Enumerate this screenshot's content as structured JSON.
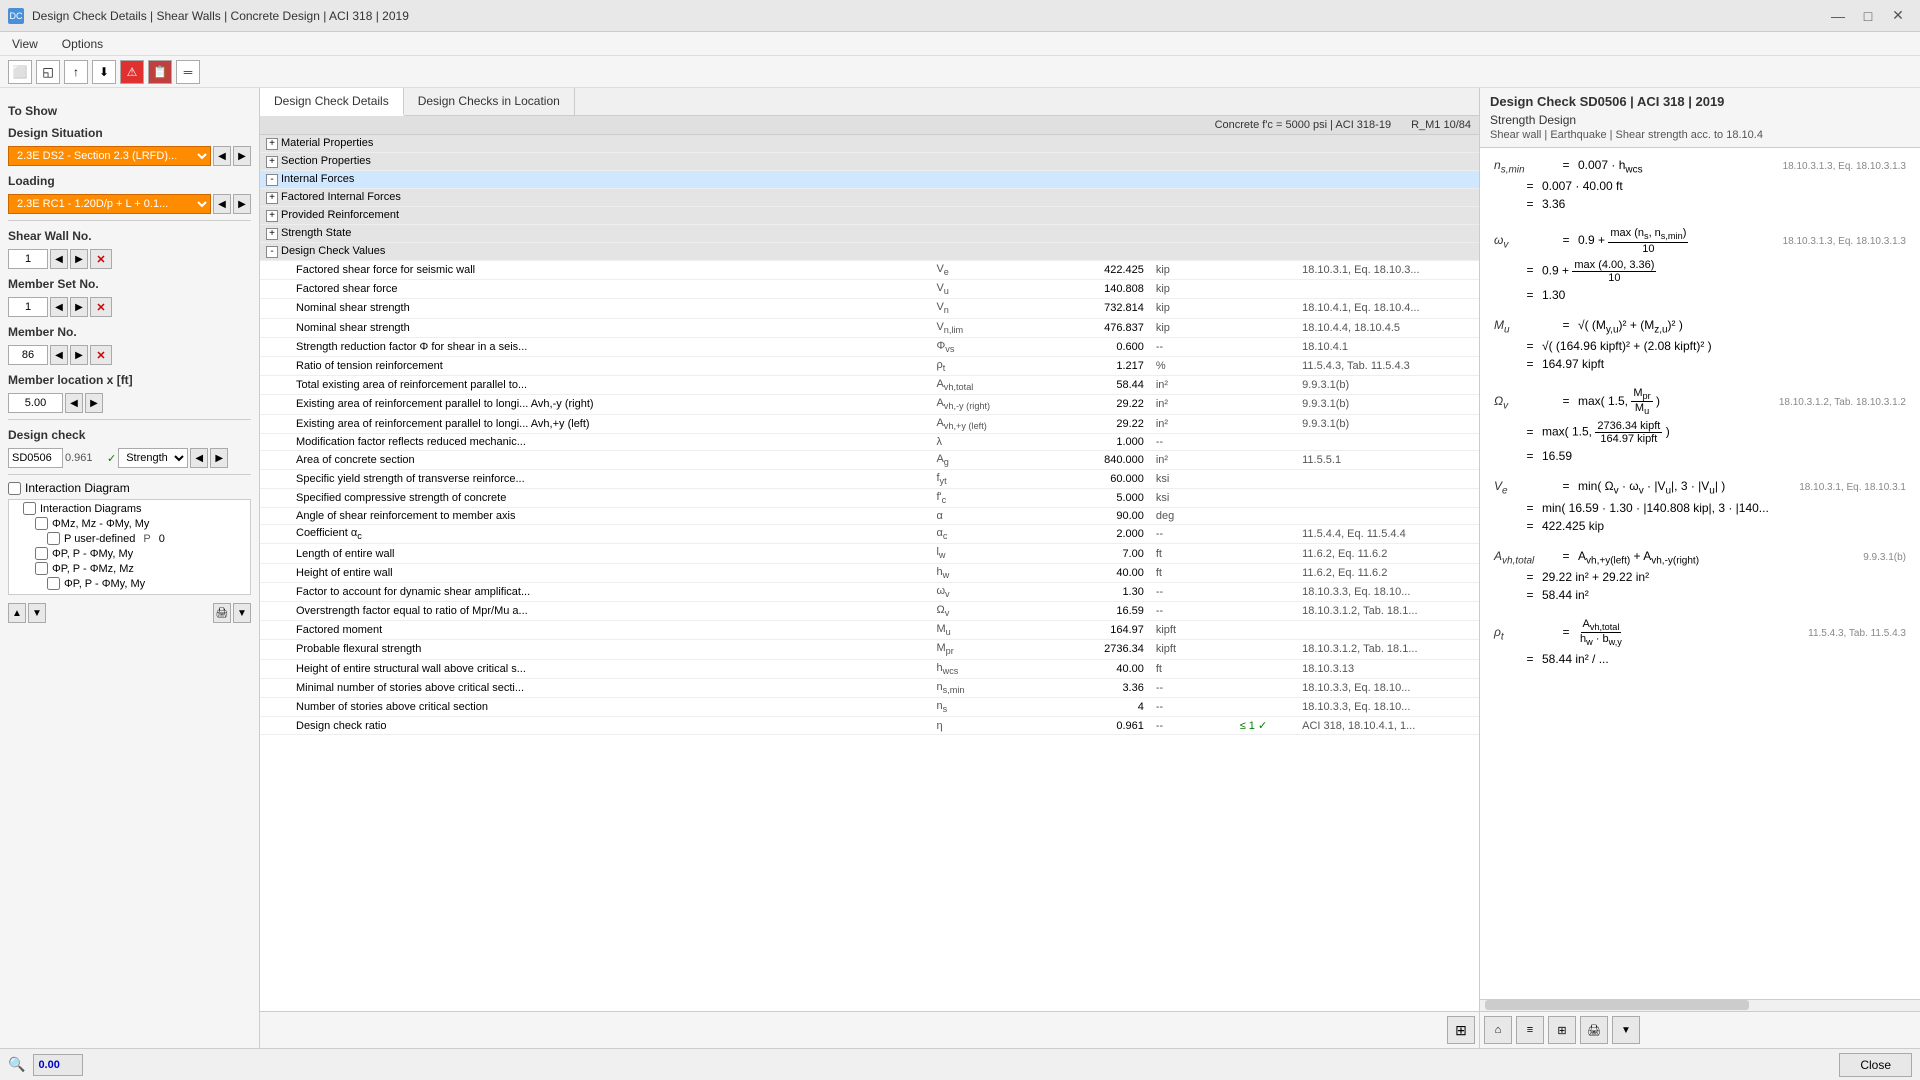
{
  "titleBar": {
    "icon": "DC",
    "title": "Design Check Details | Shear Walls | Concrete Design | ACI 318 | 2019",
    "minimizeBtn": "—",
    "maximizeBtn": "□",
    "closeBtn": "✕"
  },
  "menuBar": {
    "items": [
      "View",
      "Options"
    ]
  },
  "leftPanel": {
    "toShowLabel": "To Show",
    "designSituationLabel": "Design Situation",
    "designSituationValue": "2.3E  DS2 - Section 2.3 (LRFD)...",
    "loadingLabel": "Loading",
    "loadingValue": "2.3E  RC1 - 1.20D/p + L + 0.1...",
    "shearWallLabel": "Shear Wall No.",
    "shearWallNum": "1",
    "memberSetLabel": "Member Set No.",
    "memberSetNum": "1",
    "memberLabel": "Member No.",
    "memberNum": "86",
    "locationLabel": "Member location x [ft]",
    "locationValue": "5.00",
    "designCheckLabel": "Design check",
    "designCheckCode": "SD0506",
    "designCheckVal": "0.961",
    "designCheckStatus": "✓",
    "designCheckName": "Strength ...",
    "interactionLabel": "Interaction Diagram",
    "treeItems": [
      {
        "label": "Interaction Diagrams",
        "level": 1
      },
      {
        "label": "ΦMz, Mz - ΦMy, My",
        "level": 2
      },
      {
        "label": "P user-defined",
        "level": 3,
        "extra": "P   0"
      },
      {
        "label": "ΦP, P - ΦMy, My",
        "level": 2
      },
      {
        "label": "ΦP, P - ΦMz, Mz",
        "level": 2
      },
      {
        "label": "ΦP, P - ΦMy, My",
        "level": 3
      }
    ]
  },
  "centerPanel": {
    "tabs": [
      "Design Check Details",
      "Design Checks in Location"
    ],
    "activeTab": 0,
    "headerRight": "Concrete f'c = 5000 psi | ACI 318-19",
    "headerRight2": "R_M1 10/84",
    "sections": [
      {
        "id": "material",
        "label": "Material Properties",
        "expanded": false,
        "indent": 0
      },
      {
        "id": "section",
        "label": "Section Properties",
        "expanded": false,
        "indent": 0
      },
      {
        "id": "internal",
        "label": "Internal Forces",
        "expanded": true,
        "highlighted": true,
        "indent": 0
      },
      {
        "id": "factored",
        "label": "Factored Internal Forces",
        "expanded": false,
        "indent": 0
      },
      {
        "id": "reinforcement",
        "label": "Provided Reinforcement",
        "expanded": false,
        "indent": 0
      },
      {
        "id": "strengthState",
        "label": "Strength State",
        "expanded": false,
        "indent": 0
      },
      {
        "id": "designCheck",
        "label": "Design Check Values",
        "expanded": true,
        "indent": 0
      }
    ],
    "rows": [
      {
        "name": "Factored shear force for seismic wall",
        "sym": "Ve",
        "val": "422.425",
        "unit": "kip",
        "ref": "18.10.3.1, Eq. 18.10.3...",
        "check": ""
      },
      {
        "name": "Factored shear force",
        "sym": "Vu",
        "val": "140.808",
        "unit": "kip",
        "ref": "",
        "check": ""
      },
      {
        "name": "Nominal shear strength",
        "sym": "Vn",
        "val": "732.814",
        "unit": "kip",
        "ref": "18.10.4.1, Eq. 18.10.4...",
        "check": ""
      },
      {
        "name": "Nominal shear strength",
        "sym": "Vn,lim",
        "val": "476.837",
        "unit": "kip",
        "ref": "18.10.4.4, 18.10.4.5",
        "check": ""
      },
      {
        "name": "Strength reduction factor Φ for shear in a seis...",
        "sym": "Φvs",
        "val": "0.600",
        "unit": "--",
        "ref": "18.10.4.1",
        "check": ""
      },
      {
        "name": "Ratio of tension reinforcement",
        "sym": "ρt",
        "val": "1.217",
        "unit": "%",
        "ref": "11.5.4.3, Tab. 11.5.4.3",
        "check": ""
      },
      {
        "name": "Total existing area of reinforcement parallel to...",
        "sym": "Avh,total",
        "val": "58.44",
        "unit": "in²",
        "ref": "9.9.3.1(b)",
        "check": ""
      },
      {
        "name": "Existing area of reinforcement parallel to longi... Avh,-y (right)",
        "sym": "Avh,-y (right)",
        "val": "29.22",
        "unit": "in²",
        "ref": "9.9.3.1(b)",
        "check": ""
      },
      {
        "name": "Existing area of reinforcement parallel to longi... Avh,+y (left)",
        "sym": "Avh,+y (left)",
        "val": "29.22",
        "unit": "in²",
        "ref": "9.9.3.1(b)",
        "check": ""
      },
      {
        "name": "Modification factor reflects reduced mechanic...",
        "sym": "λ",
        "val": "1.000",
        "unit": "--",
        "ref": "",
        "check": ""
      },
      {
        "name": "Area of concrete section",
        "sym": "Ag",
        "val": "840.000",
        "unit": "in²",
        "ref": "11.5.5.1",
        "check": ""
      },
      {
        "name": "Specific yield strength of transverse reinforce...",
        "sym": "fyt",
        "val": "60.000",
        "unit": "ksi",
        "ref": "",
        "check": ""
      },
      {
        "name": "Specified compressive strength of concrete",
        "sym": "f'c",
        "val": "5.000",
        "unit": "ksi",
        "ref": "",
        "check": ""
      },
      {
        "name": "Angle of shear reinforcement to member axis",
        "sym": "α",
        "val": "90.00",
        "unit": "deg",
        "ref": "",
        "check": ""
      },
      {
        "name": "Coefficient αc",
        "sym": "αc",
        "val": "2.000",
        "unit": "--",
        "ref": "11.5.4.4, Eq. 11.5.4.4",
        "check": ""
      },
      {
        "name": "Length of entire wall",
        "sym": "lw",
        "val": "7.00",
        "unit": "ft",
        "ref": "11.6.2, Eq. 11.6.2",
        "check": ""
      },
      {
        "name": "Height of entire wall",
        "sym": "hw",
        "val": "40.00",
        "unit": "ft",
        "ref": "11.6.2, Eq. 11.6.2",
        "check": ""
      },
      {
        "name": "Factor to account for dynamic shear amplificat...",
        "sym": "ωv",
        "val": "1.30",
        "unit": "--",
        "ref": "18.10.3.3, Eq. 18.10...",
        "check": ""
      },
      {
        "name": "Overstrength factor equal to ratio of Mpr/Mu a...",
        "sym": "Ωv",
        "val": "16.59",
        "unit": "--",
        "ref": "18.10.3.1.2, Tab. 18.1...",
        "check": ""
      },
      {
        "name": "Factored moment",
        "sym": "Mu",
        "val": "164.97",
        "unit": "kipft",
        "ref": "",
        "check": ""
      },
      {
        "name": "Probable flexural strength",
        "sym": "Mpr",
        "val": "2736.34",
        "unit": "kipft",
        "ref": "18.10.3.1.2, Tab. 18.1...",
        "check": ""
      },
      {
        "name": "Height of entire structural wall above critical s...",
        "sym": "hwcs",
        "val": "40.00",
        "unit": "ft",
        "ref": "18.10.3.13",
        "check": ""
      },
      {
        "name": "Minimal number of stories above critical secti...",
        "sym": "ns,min",
        "val": "3.36",
        "unit": "--",
        "ref": "18.10.3.3, Eq. 18.10...",
        "check": ""
      },
      {
        "name": "Number of stories above critical section",
        "sym": "ns",
        "val": "4",
        "unit": "--",
        "ref": "18.10.3.3, Eq. 18.10...",
        "check": ""
      },
      {
        "name": "Design check ratio",
        "sym": "η",
        "val": "0.961",
        "unit": "--",
        "ref": "≤ 1  ✓  ACI 318, 18.10.4.1, 1...",
        "check": "✓"
      }
    ]
  },
  "rightPanel": {
    "title": "Design Check SD0506 | ACI 318 | 2019",
    "subtitle": "Strength Design",
    "desc": "Shear wall | Earthquake | Shear strength acc. to 18.10.4",
    "mathBlocks": [
      {
        "id": "ns_min",
        "lines": [
          {
            "sym": "ns,min",
            "eq": "=",
            "expr": "0.007 · hwcs",
            "ref": "18.10.3.1.3, Eq. 18.10.3.1.3"
          },
          {
            "sym": "",
            "eq": "=",
            "expr": "0.007 · 40.00 ft",
            "ref": ""
          },
          {
            "sym": "",
            "eq": "=",
            "expr": "3.36",
            "ref": ""
          }
        ]
      },
      {
        "id": "omega_v",
        "lines": [
          {
            "sym": "ωv",
            "eq": "=",
            "expr": "0.9 + max(ns, ns,min) / 10",
            "ref": "18.10.3.1.3, Eq. 18.10.3.1.3"
          },
          {
            "sym": "",
            "eq": "=",
            "expr": "0.9 + max(4.00, 3.36) / 10",
            "ref": ""
          },
          {
            "sym": "",
            "eq": "=",
            "expr": "1.30",
            "ref": ""
          }
        ]
      },
      {
        "id": "Mu",
        "lines": [
          {
            "sym": "Mu",
            "eq": "=",
            "expr": "√( (My,u)² + (Mz,u)² )",
            "ref": ""
          },
          {
            "sym": "",
            "eq": "=",
            "expr": "√( (164.96 kipft)² + (2.08 kipft)² )",
            "ref": ""
          },
          {
            "sym": "",
            "eq": "=",
            "expr": "164.97 kipft",
            "ref": ""
          }
        ]
      },
      {
        "id": "Omega_v",
        "lines": [
          {
            "sym": "Ωv",
            "eq": "=",
            "expr": "max( 1.5, Mpr / Mu )",
            "ref": "18.10.3.1.2, Tab. 18.10.3.1.2"
          },
          {
            "sym": "",
            "eq": "=",
            "expr": "max( 1.5, 2736.34 kipft / 164.97 kipft )",
            "ref": ""
          },
          {
            "sym": "",
            "eq": "=",
            "expr": "16.59",
            "ref": ""
          }
        ]
      },
      {
        "id": "Ve",
        "lines": [
          {
            "sym": "Ve",
            "eq": "=",
            "expr": "min( Ωv · ωv · |Vu|, 3 · |Vu| )",
            "ref": "18.10.3.1, Eq. 18.10.3.1"
          },
          {
            "sym": "",
            "eq": "=",
            "expr": "min( 16.59 · 1.30 · |140.808 kip|, 3 · |140...",
            "ref": ""
          },
          {
            "sym": "",
            "eq": "=",
            "expr": "422.425 kip",
            "ref": ""
          }
        ]
      },
      {
        "id": "Avh_total",
        "lines": [
          {
            "sym": "Avh,total",
            "eq": "=",
            "expr": "Avh,+y(left) + Avh,-y(right)",
            "ref": "9.9.3.1(b)"
          },
          {
            "sym": "",
            "eq": "=",
            "expr": "29.22 in² + 29.22 in²",
            "ref": ""
          },
          {
            "sym": "",
            "eq": "=",
            "expr": "58.44 in²",
            "ref": ""
          }
        ]
      },
      {
        "id": "rho_t",
        "lines": [
          {
            "sym": "ρt",
            "eq": "=",
            "expr": "Avh,total / (hw · bw,y)",
            "ref": "11.5.4.3, Tab. 11.5.4.3"
          },
          {
            "sym": "",
            "eq": "=",
            "expr": "58.44 in² / ...",
            "ref": ""
          }
        ]
      }
    ]
  },
  "statusBar": {
    "searchIcon": "🔍",
    "inputValue": "0.00",
    "closeBtn": "Close"
  }
}
